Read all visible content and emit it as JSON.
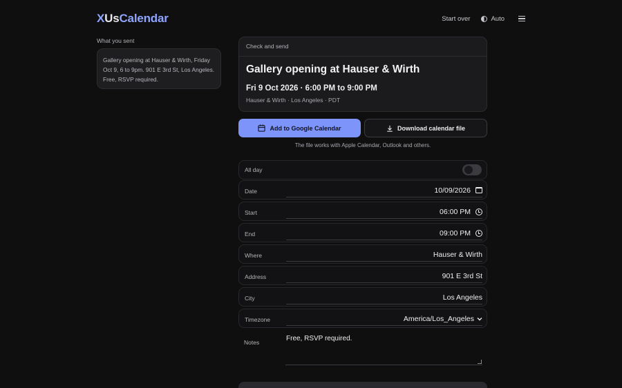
{
  "header": {
    "logo_x": "X",
    "logo_us": "Us",
    "logo_calendar": "Calendar",
    "start_over": "Start over",
    "theme_label": "Auto",
    "theme_icon": "contrast-icon",
    "menu_icon": "menu-icon"
  },
  "sent": {
    "label": "What you sent",
    "text": "Gallery opening at Hauser & Wirth, Friday Oct 9, 6 to 9pm. 901 E 3rd St, Los Angeles. Free, RSVP required."
  },
  "card": {
    "header": "Check and send",
    "title": "Gallery opening at Hauser & Wirth",
    "when": "Fri 9 Oct 2026 · 6:00 PM to 9:00 PM",
    "where": "Hauser & Wirth · Los Angeles · PDT"
  },
  "actions": {
    "google_label": "Add to Google Calendar",
    "download_label": "Download calendar file",
    "note": "The file works with Apple Calendar, Outlook and others.",
    "accent_color": "#7d94fb"
  },
  "form": {
    "all_day_label": "All day",
    "date_label": "Date",
    "date_value": "10/09/2026",
    "start_label": "Start",
    "start_value": "06:00 PM",
    "end_label": "End",
    "end_value": "09:00 PM",
    "where_label": "Where",
    "where_value": "Hauser & Wirth",
    "address_label": "Address",
    "address_value": "901 E 3rd St",
    "city_label": "City",
    "city_value": "Los Angeles",
    "timezone_label": "Timezone",
    "timezone_value": "America/Los_Angeles",
    "notes_label": "Notes",
    "notes_value": "Free, RSVP required."
  }
}
